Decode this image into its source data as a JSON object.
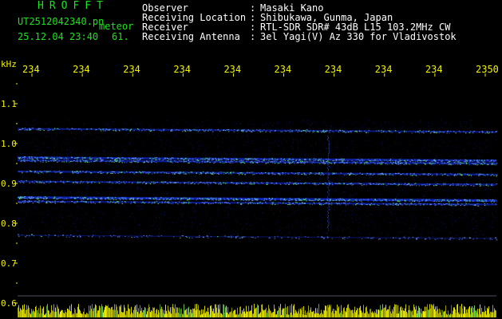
{
  "header": {
    "brand": "HROFFT",
    "filename": "UT2512042340.pn",
    "meteor_label": "meteor",
    "datetime": "25.12.04 23:40",
    "count": "61."
  },
  "info": [
    {
      "label": "Observer",
      "value": "Masaki Kano"
    },
    {
      "label": "Receiving Location",
      "value": "Shibukawa, Gunma, Japan"
    },
    {
      "label": "Receiver",
      "value": "RTL-SDR SDR# 43dB L15 103.2MHz CW"
    },
    {
      "label": "Receiving Antenna",
      "value": "3el Yagi(V) Az 330 for Vladivostok"
    }
  ],
  "colors": {
    "header_text": "#19e619",
    "info_text": "#ffffff",
    "axis_text": "#f2f200",
    "background": "#000000",
    "echo_high": "#5aff5a",
    "echo_low": "#1428c8"
  },
  "chart_data": {
    "type": "heatmap",
    "y_unit_label": "kHz",
    "y_ticks": [
      "1.1",
      "1.0",
      "0.9",
      "0.8",
      "0.7",
      "0.6"
    ],
    "y_values": [
      1.1,
      1.0,
      0.9,
      0.8,
      0.7,
      0.6
    ],
    "x_ticks": [
      "234",
      "234",
      "234",
      "234",
      "234",
      "234",
      "234",
      "234",
      "234",
      "2350"
    ],
    "bands": [
      {
        "freq_khz": 1.037,
        "intensity": 0.55
      },
      {
        "freq_khz": 0.965,
        "intensity": 0.85
      },
      {
        "freq_khz": 0.958,
        "intensity": 0.7
      },
      {
        "freq_khz": 0.93,
        "intensity": 0.65
      },
      {
        "freq_khz": 0.905,
        "intensity": 0.6
      },
      {
        "freq_khz": 0.865,
        "intensity": 1.0
      },
      {
        "freq_khz": 0.855,
        "intensity": 0.6
      },
      {
        "freq_khz": 0.77,
        "intensity": 0.15
      }
    ]
  }
}
